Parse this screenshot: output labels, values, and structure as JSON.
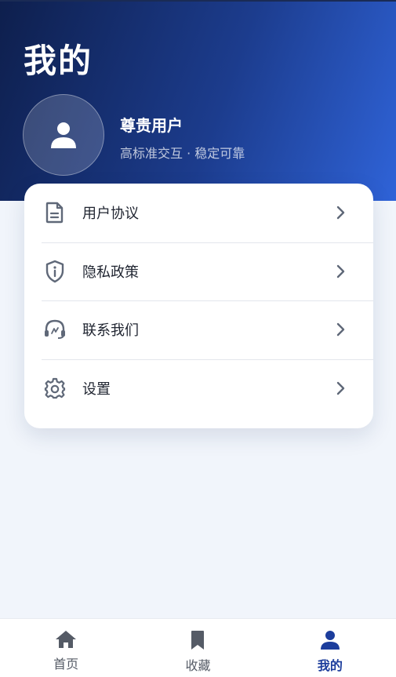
{
  "header": {
    "title": "我的",
    "user_name": "尊贵用户",
    "user_subtitle": "高标准交互 · 稳定可靠"
  },
  "menu": {
    "items": [
      {
        "label": "用户协议",
        "icon": "document-icon"
      },
      {
        "label": "隐私政策",
        "icon": "shield-info-icon"
      },
      {
        "label": "联系我们",
        "icon": "headset-icon"
      },
      {
        "label": "设置",
        "icon": "gear-icon"
      }
    ]
  },
  "tabbar": {
    "items": [
      {
        "label": "首页",
        "icon": "home-icon",
        "active": false
      },
      {
        "label": "收藏",
        "icon": "bookmark-icon",
        "active": false
      },
      {
        "label": "我的",
        "icon": "user-icon",
        "active": true
      }
    ]
  },
  "colors": {
    "header_gradient_start": "#0e1f4d",
    "header_gradient_end": "#2f63d8",
    "active_tab": "#1c3d9c",
    "inactive_tab": "#555b66",
    "icon_gray": "#5f6878"
  }
}
